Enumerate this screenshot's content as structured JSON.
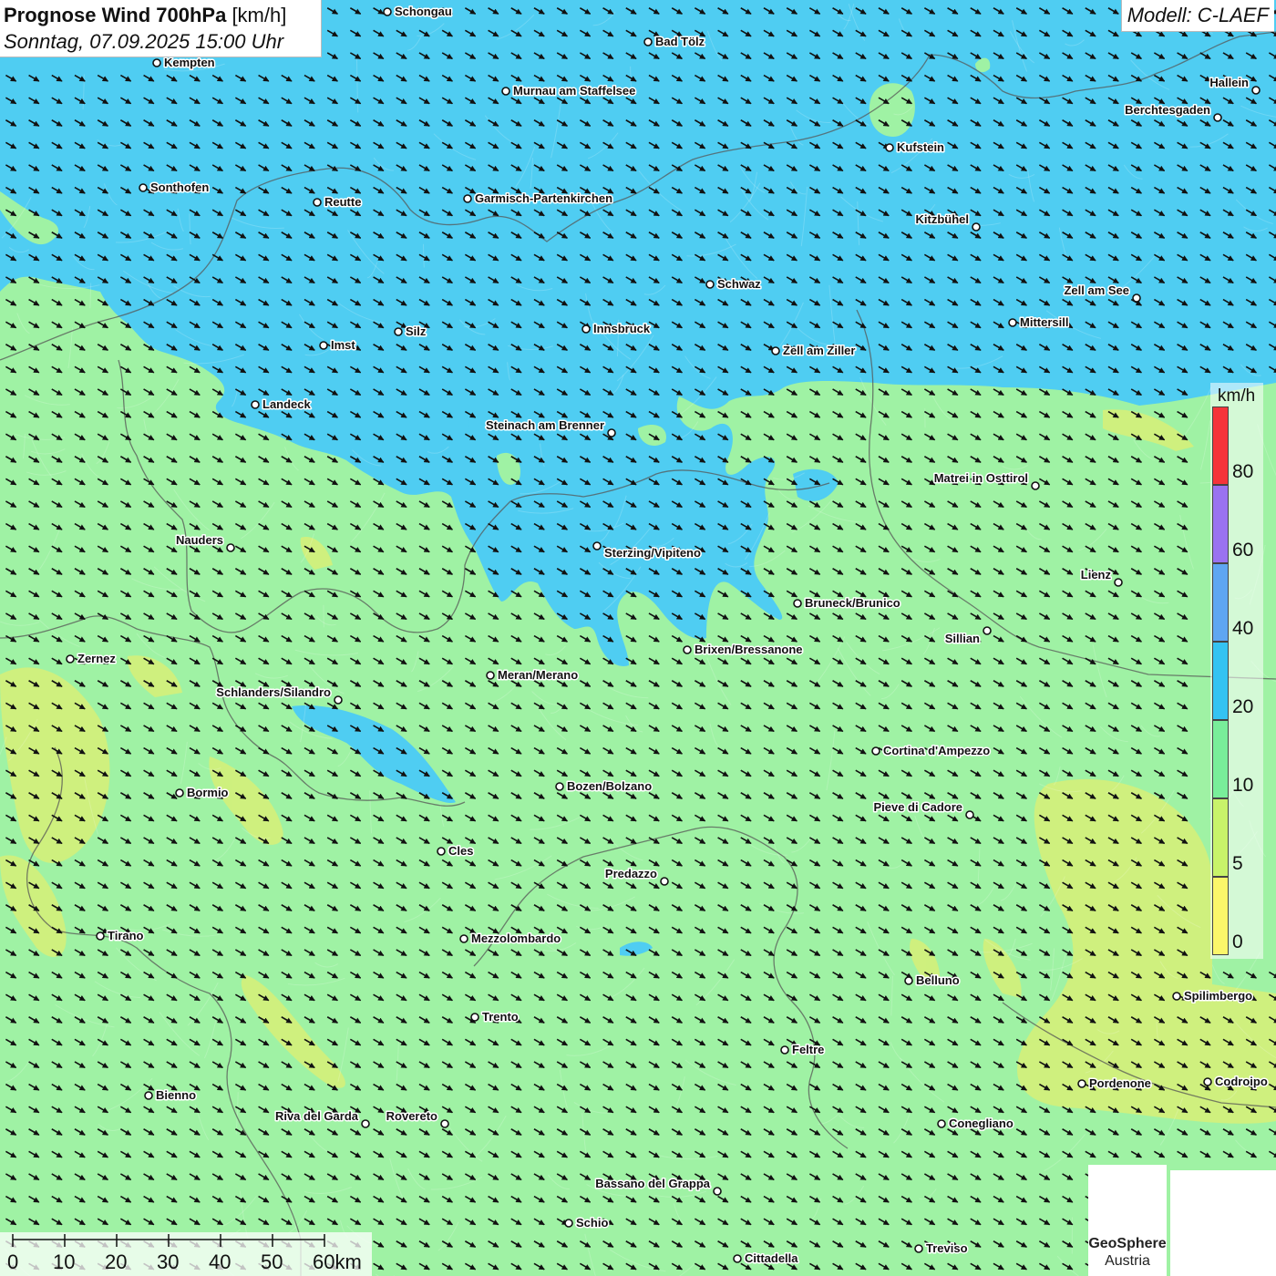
{
  "header": {
    "title_bold": "Prognose Wind 700hPa",
    "title_unit": "[km/h]",
    "datetime": "Sonntag, 07.09.2025 15:00 Uhr",
    "model": "Modell: C-LAEF"
  },
  "legend": {
    "unit": "km/h",
    "ticks": [
      "80",
      "60",
      "40",
      "20",
      "10",
      "5",
      "0"
    ],
    "colors": [
      "#f5343a",
      "#9a72f0",
      "#5fa6f2",
      "#34c3f2",
      "#79ee9a",
      "#c8f36a",
      "#fbf66a"
    ]
  },
  "scale_bar": {
    "labels": [
      "0",
      "10",
      "20",
      "30",
      "40",
      "50",
      "60km"
    ]
  },
  "logos": {
    "geosphere_line1": "GeoSphere",
    "geosphere_line2": "Austria"
  },
  "cities": [
    {
      "name": "Schongau"
    },
    {
      "name": "Bad Tölz"
    },
    {
      "name": "Kempten"
    },
    {
      "name": "Murnau am Staffelsee"
    },
    {
      "name": "Hallein"
    },
    {
      "name": "Berchtesgaden"
    },
    {
      "name": "Kufstein"
    },
    {
      "name": "Sonthofen"
    },
    {
      "name": "Reutte"
    },
    {
      "name": "Garmisch-Partenkirchen"
    },
    {
      "name": "Kitzbühel"
    },
    {
      "name": "Schwaz"
    },
    {
      "name": "Zell am See"
    },
    {
      "name": "Mittersill"
    },
    {
      "name": "Imst"
    },
    {
      "name": "Silz"
    },
    {
      "name": "Innsbruck"
    },
    {
      "name": "Zell am Ziller"
    },
    {
      "name": "Landeck"
    },
    {
      "name": "Steinach am Brenner"
    },
    {
      "name": "Matrei in Osttirol"
    },
    {
      "name": "Nauders"
    },
    {
      "name": "Sterzing/Vipiteno"
    },
    {
      "name": "Lienz"
    },
    {
      "name": "Bruneck/Brunico"
    },
    {
      "name": "Sillian"
    },
    {
      "name": "Zernez"
    },
    {
      "name": "Brixen/Bressanone"
    },
    {
      "name": "Meran/Merano"
    },
    {
      "name": "Schlanders/Silandro"
    },
    {
      "name": "Cortina d'Ampezzo"
    },
    {
      "name": "Bozen/Bolzano"
    },
    {
      "name": "Bormio"
    },
    {
      "name": "Pieve di Cadore"
    },
    {
      "name": "Cles"
    },
    {
      "name": "Predazzo"
    },
    {
      "name": "Tirano"
    },
    {
      "name": "Mezzolombardo"
    },
    {
      "name": "Belluno"
    },
    {
      "name": "Spilimbergo"
    },
    {
      "name": "Trento"
    },
    {
      "name": "Feltre"
    },
    {
      "name": "Pordenone"
    },
    {
      "name": "Codroipo"
    },
    {
      "name": "Bienno"
    },
    {
      "name": "Riva del Garda"
    },
    {
      "name": "Rovereto"
    },
    {
      "name": "Conegliano"
    },
    {
      "name": "Bassano del Grappa"
    },
    {
      "name": "Schio"
    },
    {
      "name": "Treviso"
    },
    {
      "name": "Cittadella"
    }
  ],
  "wind": {
    "direction_to_deg": 120,
    "zones": [
      {
        "level": "20-40 km/h",
        "color": "#4fcdf2"
      },
      {
        "level": "10-20 km/h",
        "color": "#9ff2a4"
      },
      {
        "level": "5-10 km/h",
        "color": "#d4f07a"
      }
    ]
  }
}
